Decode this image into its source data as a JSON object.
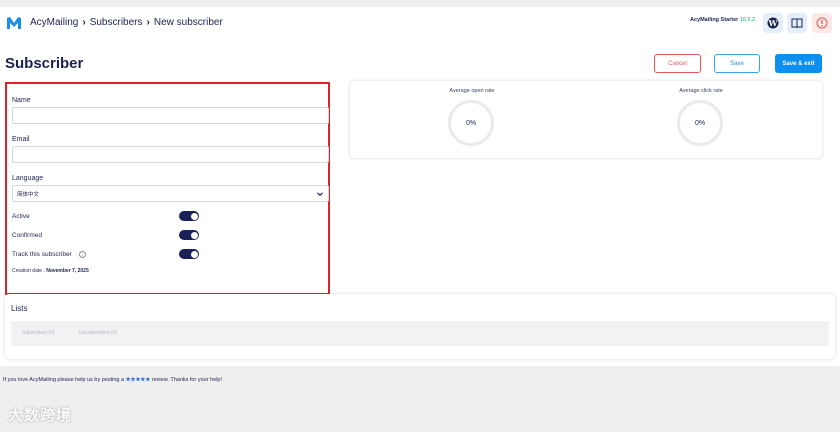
{
  "header": {
    "breadcrumb": [
      "AcyMailing",
      "Subscribers",
      "New subscriber"
    ],
    "plan_name": "AcyMailing Starter",
    "plan_version": "10.5.2"
  },
  "page": {
    "title": "Subscriber",
    "cancel_label": "Cancel",
    "save_label": "Save",
    "save_exit_label": "Save & exit"
  },
  "form": {
    "name_label": "Name",
    "name_value": "",
    "email_label": "Email",
    "email_value": "",
    "language_label": "Language",
    "language_value": "简体中文",
    "active_label": "Active",
    "active_on": true,
    "confirmed_label": "Confirmed",
    "confirmed_on": true,
    "track_label": "Track this subscriber",
    "track_on": true,
    "info_glyph": "i",
    "creation_date_label": "Creation date :",
    "creation_date_value": "November 7, 2025"
  },
  "stats": {
    "open_rate_label": "Average open rate",
    "open_rate_value": "0%",
    "click_rate_label": "Average click rate",
    "click_rate_value": "0%"
  },
  "lists": {
    "title": "Lists",
    "tabs": [
      "Subscribed (0)",
      "Unsubscribed (0)"
    ]
  },
  "footer": {
    "text_before": "If you love AcyMailing please help us by posting a",
    "stars": "★★★★★",
    "text_after": "review. Thanks for your help!"
  },
  "watermark": "大数跨境",
  "colors": {
    "brand_navy": "#1c2350",
    "cancel_red": "#e05a5a",
    "primary_blue": "#0d8ff0",
    "toggle_on": "#1b1f57",
    "highlight_red": "#d9252a"
  }
}
